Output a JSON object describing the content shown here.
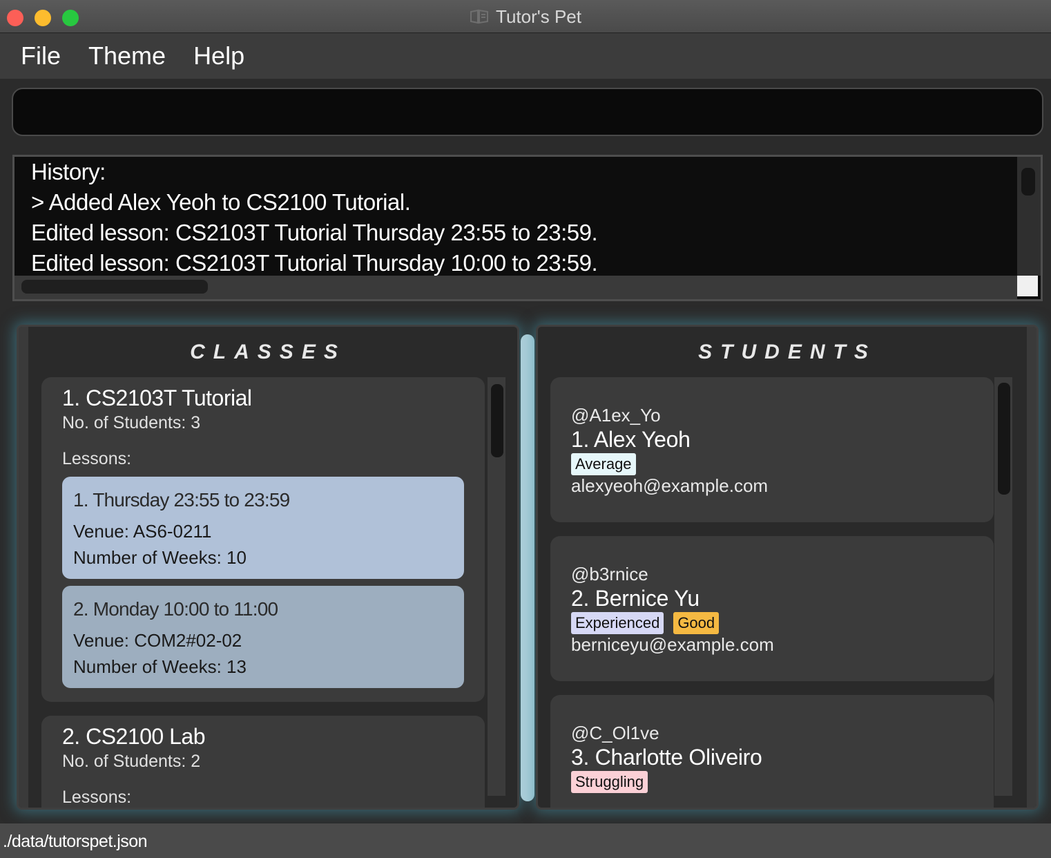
{
  "window": {
    "title": "Tutor's Pet",
    "colors": {
      "close": "#fc5f57",
      "minimize": "#fdbc2e",
      "zoom": "#28c840"
    }
  },
  "menu": [
    "File",
    "Theme",
    "Help"
  ],
  "command": {
    "value": "",
    "placeholder": ""
  },
  "history": {
    "lines": [
      "History:",
      "> Added Alex Yeoh to CS2100 Tutorial.",
      "Edited lesson: CS2103T Tutorial Thursday 23:55 to 23:59.",
      "Edited lesson: CS2103T Tutorial Thursday 10:00 to 23:59."
    ]
  },
  "classes": {
    "heading": "CLASSES",
    "items": [
      {
        "title": "1.  CS2103T Tutorial",
        "students": "No. of Students:  3",
        "lessons_label": "Lessons:",
        "lessons": [
          {
            "title": "1. Thursday 23:55 to 23:59",
            "venue": "Venue: AS6-0211",
            "weeks": "Number of Weeks: 10"
          },
          {
            "title": "2. Monday 10:00 to 11:00",
            "venue": "Venue: COM2#02-02",
            "weeks": "Number of Weeks: 13"
          }
        ]
      },
      {
        "title": "2.  CS2100 Lab",
        "students": "No. of Students:  2",
        "lessons_label": "Lessons:"
      }
    ]
  },
  "students": {
    "heading": "STUDENTS",
    "items": [
      {
        "telegram": "@A1ex_Yo",
        "name": "1.  Alex Yeoh",
        "tags": [
          {
            "label": "Average",
            "color": "#e6f7fa"
          }
        ],
        "email": "alexyeoh@example.com"
      },
      {
        "telegram": "@b3rnice",
        "name": "2.  Bernice Yu",
        "tags": [
          {
            "label": "Experienced",
            "color": "#d6d8f5"
          },
          {
            "label": "Good",
            "color": "#f5b942"
          }
        ],
        "email": "berniceyu@example.com"
      },
      {
        "telegram": "@C_Ol1ve",
        "name": "3.  Charlotte Oliveiro",
        "tags": [
          {
            "label": "Struggling",
            "color": "#fbd0d6"
          }
        ],
        "email": ""
      }
    ]
  },
  "status": {
    "file_path": "./data/tutorspet.json"
  }
}
